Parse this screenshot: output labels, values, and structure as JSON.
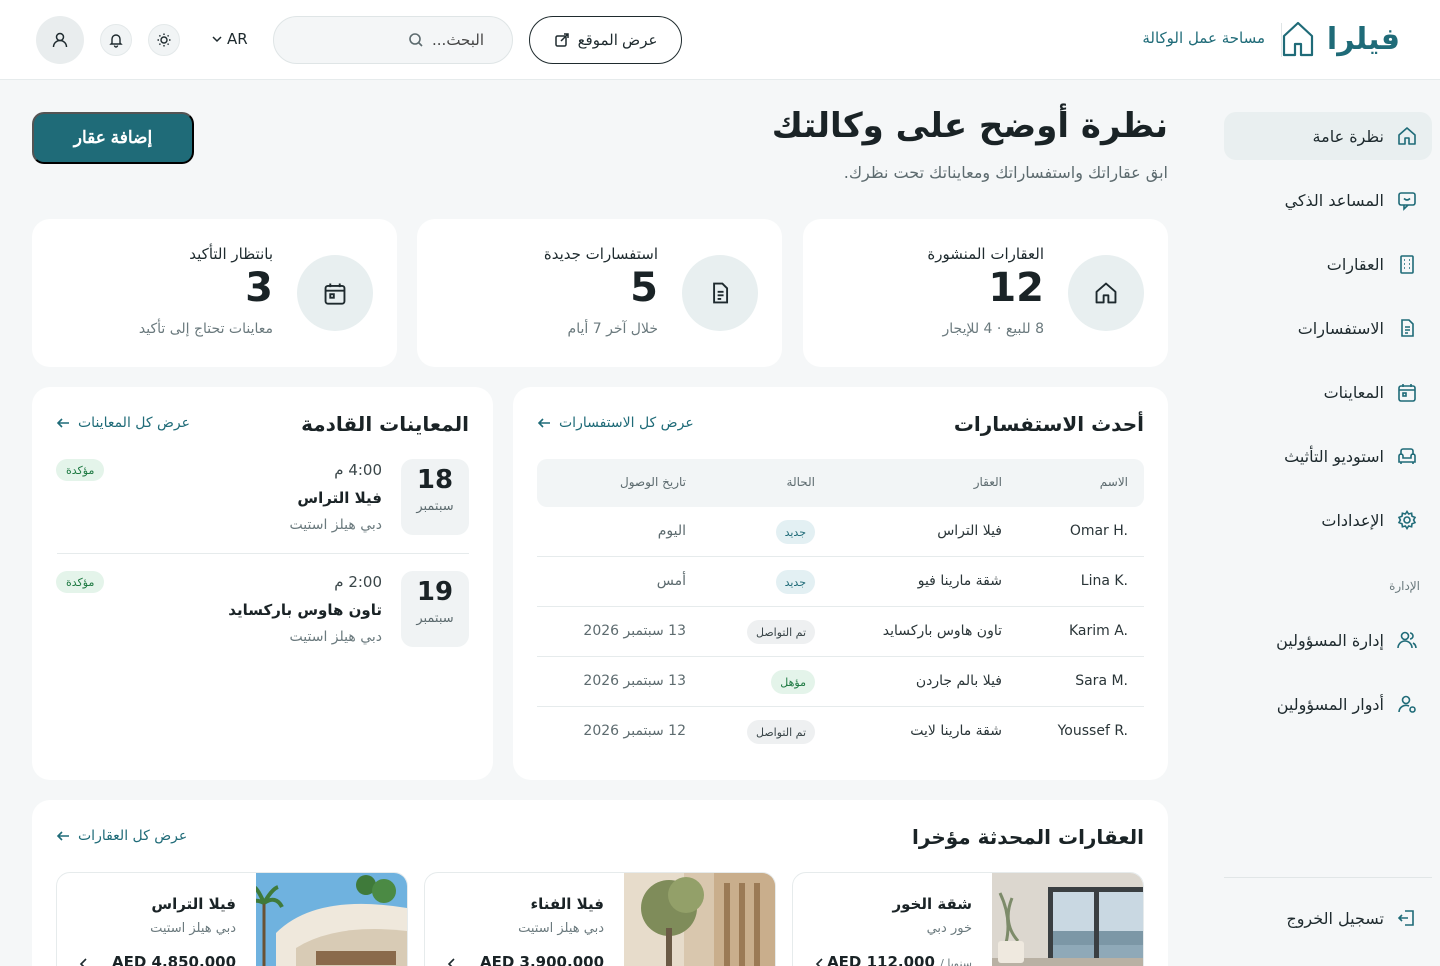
{
  "header": {
    "brand": "فيلرا",
    "workspace_link": "مساحة عمل الوكالة",
    "view_site": "عرض الموقع",
    "search_placeholder": "البحث...",
    "language": "AR"
  },
  "sidebar": {
    "items": [
      {
        "label": "نظرة عامة",
        "icon": "home-icon"
      },
      {
        "label": "المساعد الذكي",
        "icon": "chat-assistant-icon"
      },
      {
        "label": "العقارات",
        "icon": "building-icon"
      },
      {
        "label": "الاستفسارات",
        "icon": "document-icon"
      },
      {
        "label": "المعاينات",
        "icon": "calendar-icon"
      },
      {
        "label": "استوديو التأثيث",
        "icon": "sofa-icon"
      },
      {
        "label": "الإعدادات",
        "icon": "gear-icon"
      }
    ],
    "admin_section": "الإدارة",
    "admin_items": [
      {
        "label": "إدارة المسؤولين",
        "icon": "users-icon"
      },
      {
        "label": "أدوار المسؤولين",
        "icon": "user-role-icon"
      }
    ],
    "logout": "تسجيل الخروج"
  },
  "page": {
    "title": "نظرة أوضح على وكالتك",
    "subtitle": "ابق عقاراتك واستفساراتك ومعايناتك تحت نظرك.",
    "add_property": "إضافة عقار"
  },
  "stats": [
    {
      "label": "العقارات المنشورة",
      "value": "12",
      "sub": "8 للبيع · 4 للإيجار",
      "icon": "home-icon"
    },
    {
      "label": "استفسارات جديدة",
      "value": "5",
      "sub": "خلال آخر 7 أيام",
      "icon": "document-icon"
    },
    {
      "label": "بانتظار التأكيد",
      "value": "3",
      "sub": "معاينات تحتاج إلى تأكيد",
      "icon": "calendar-icon"
    }
  ],
  "inquiries": {
    "title": "أحدث الاستفسارات",
    "view_all": "عرض كل الاستفسارات",
    "columns": [
      "الاسم",
      "العقار",
      "الحالة",
      "تاريخ الوصول"
    ],
    "rows": [
      {
        "name": "Omar H.",
        "property": "فيلا التراس",
        "status": "جديد",
        "date": "اليوم"
      },
      {
        "name": "Lina K.",
        "property": "شقة مارينا فيو",
        "status": "جديد",
        "date": "أمس"
      },
      {
        "name": "Karim A.",
        "property": "تاون هاوس باركسايد",
        "status": "تم التواصل",
        "date": "13 سبتمبر 2026"
      },
      {
        "name": "Sara M.",
        "property": "فيلا بالم جاردن",
        "status": "مؤهل",
        "date": "13 سبتمبر 2026"
      },
      {
        "name": "Youssef R.",
        "property": "شقة مارينا لايت",
        "status": "تم التواصل",
        "date": "12 سبتمبر 2026"
      }
    ],
    "status_colors": {
      "جديد": {
        "bg": "#e3f0f3",
        "fg": "#1f6b78"
      },
      "تم التواصل": {
        "bg": "#eef0f1",
        "fg": "#3a4649"
      },
      "مؤهل": {
        "bg": "#e4f4ea",
        "fg": "#1f7a43"
      }
    }
  },
  "appointments": {
    "title": "المعاينات القادمة",
    "view_all": "عرض كل المعاينات",
    "items": [
      {
        "day": "18",
        "month": "سبتمبر",
        "time": "4:00 م",
        "property": "فيلا التراس",
        "agency": "دبي هيلز استيت",
        "status": "مؤكدة"
      },
      {
        "day": "19",
        "month": "سبتمبر",
        "time": "2:00 م",
        "property": "تاون هاوس باركسايد",
        "agency": "دبي هيلز استيت",
        "status": "مؤكدة"
      }
    ]
  },
  "recent_properties": {
    "title": "العقارات المحدثة مؤخرا",
    "view_all": "عرض كل العقارات",
    "items": [
      {
        "name": "شقة الخور",
        "location": "خور دبي",
        "price": "AED 112,000",
        "price_suffix": "/ سنويا"
      },
      {
        "name": "فيلا الفناء",
        "location": "دبي هيلز استيت",
        "price": "AED 3,900,000"
      },
      {
        "name": "فيلا التراس",
        "location": "دبي هيلز استيت",
        "price": "AED 4,850,000"
      }
    ]
  },
  "colors": {
    "accent": "#1f6b78",
    "background": "#f5f7f8",
    "card": "#ffffff"
  }
}
